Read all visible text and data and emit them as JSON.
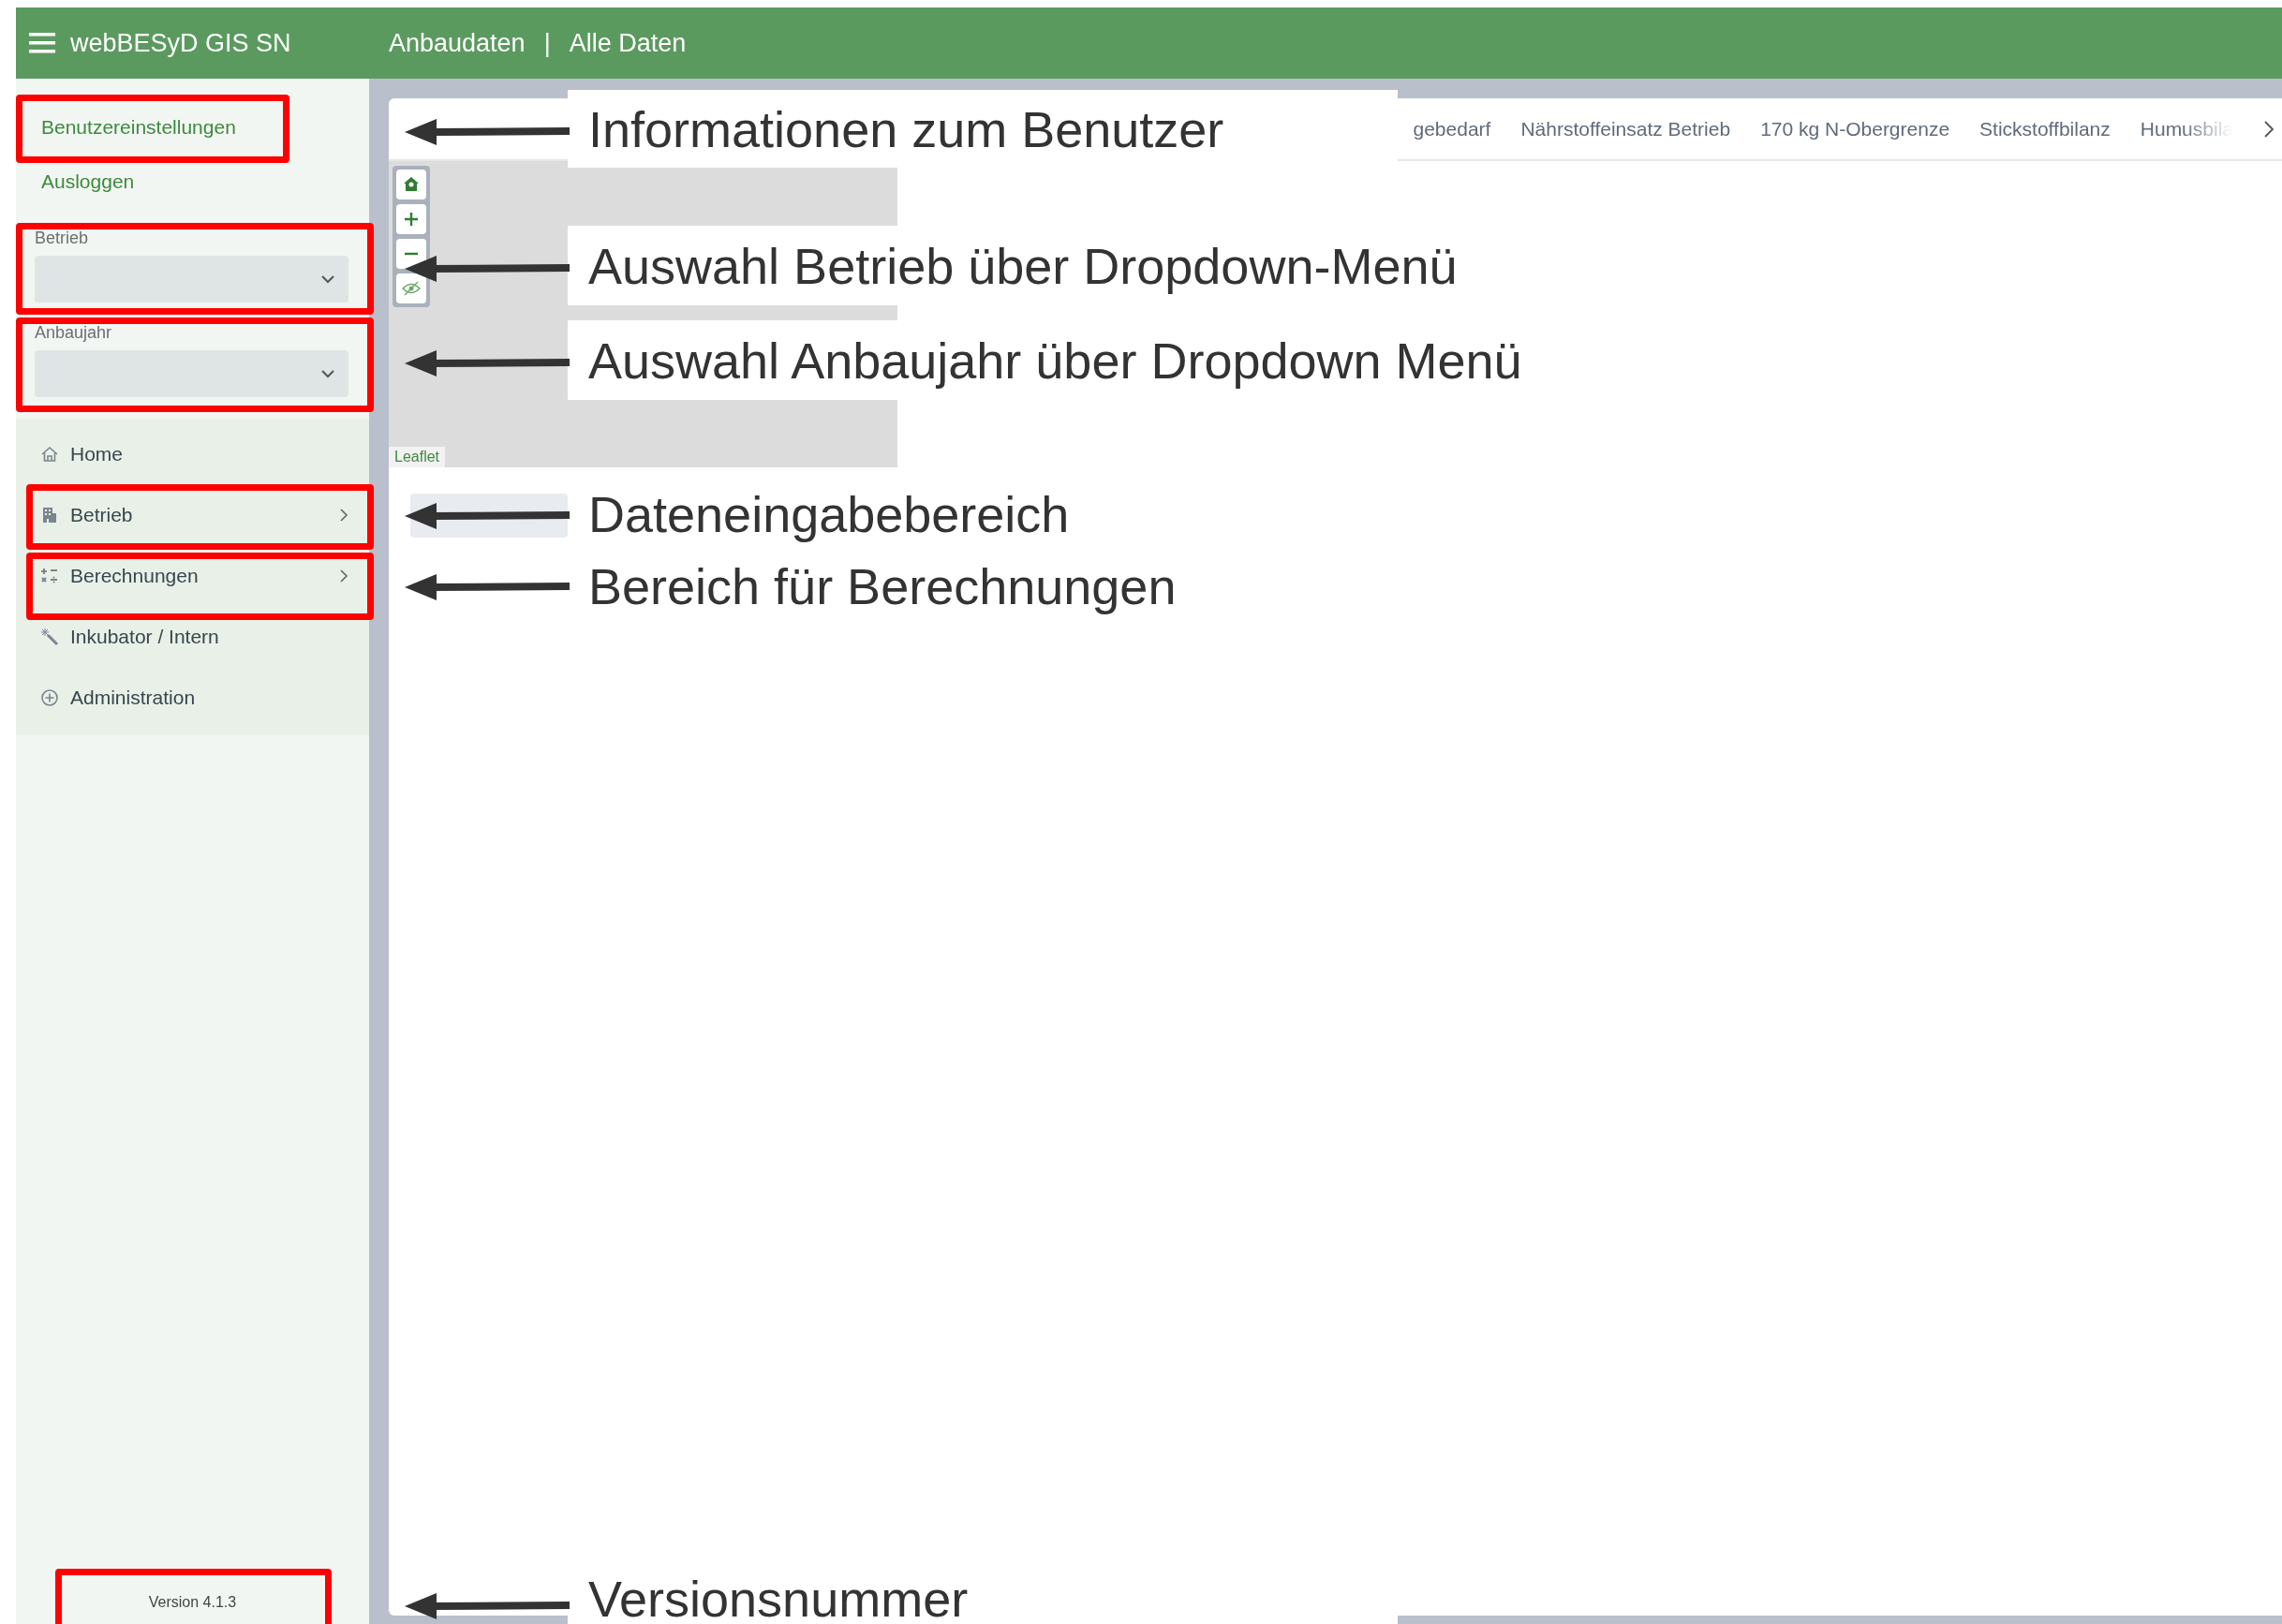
{
  "header": {
    "title": "webBESyD GIS SN",
    "nav": [
      "Anbaudaten",
      "Alle Daten"
    ],
    "separator": "|"
  },
  "sidebar": {
    "user_links": [
      "Benutzereinstellungen",
      "Ausloggen"
    ],
    "selects": [
      {
        "label": "Betrieb"
      },
      {
        "label": "Anbaujahr"
      }
    ],
    "menu": [
      {
        "label": "Home",
        "expandable": false
      },
      {
        "label": "Betrieb",
        "expandable": true
      },
      {
        "label": "Berechnungen",
        "expandable": true
      },
      {
        "label": "Inkubator / Intern",
        "expandable": false
      },
      {
        "label": "Administration",
        "expandable": false
      }
    ],
    "version": "Version 4.1.3"
  },
  "tabs": [
    {
      "label": "gebedarf",
      "faded": false
    },
    {
      "label": "Nährstoffeinsatz Betrieb",
      "faded": false
    },
    {
      "label": "170 kg N-Obergrenze",
      "faded": false
    },
    {
      "label": "Stickstoffbilanz",
      "faded": false
    },
    {
      "label": "Humusbila",
      "faded": true
    }
  ],
  "map": {
    "attribution": "Leaflet"
  },
  "annotations": [
    "Informationen zum Benutzer",
    "Auswahl Betrieb über Dropdown-Menü",
    "Auswahl Anbaujahr über Dropdown Menü",
    "Dateneingabebereich",
    "Bereich für Berechnungen",
    "Versionsnummer"
  ]
}
